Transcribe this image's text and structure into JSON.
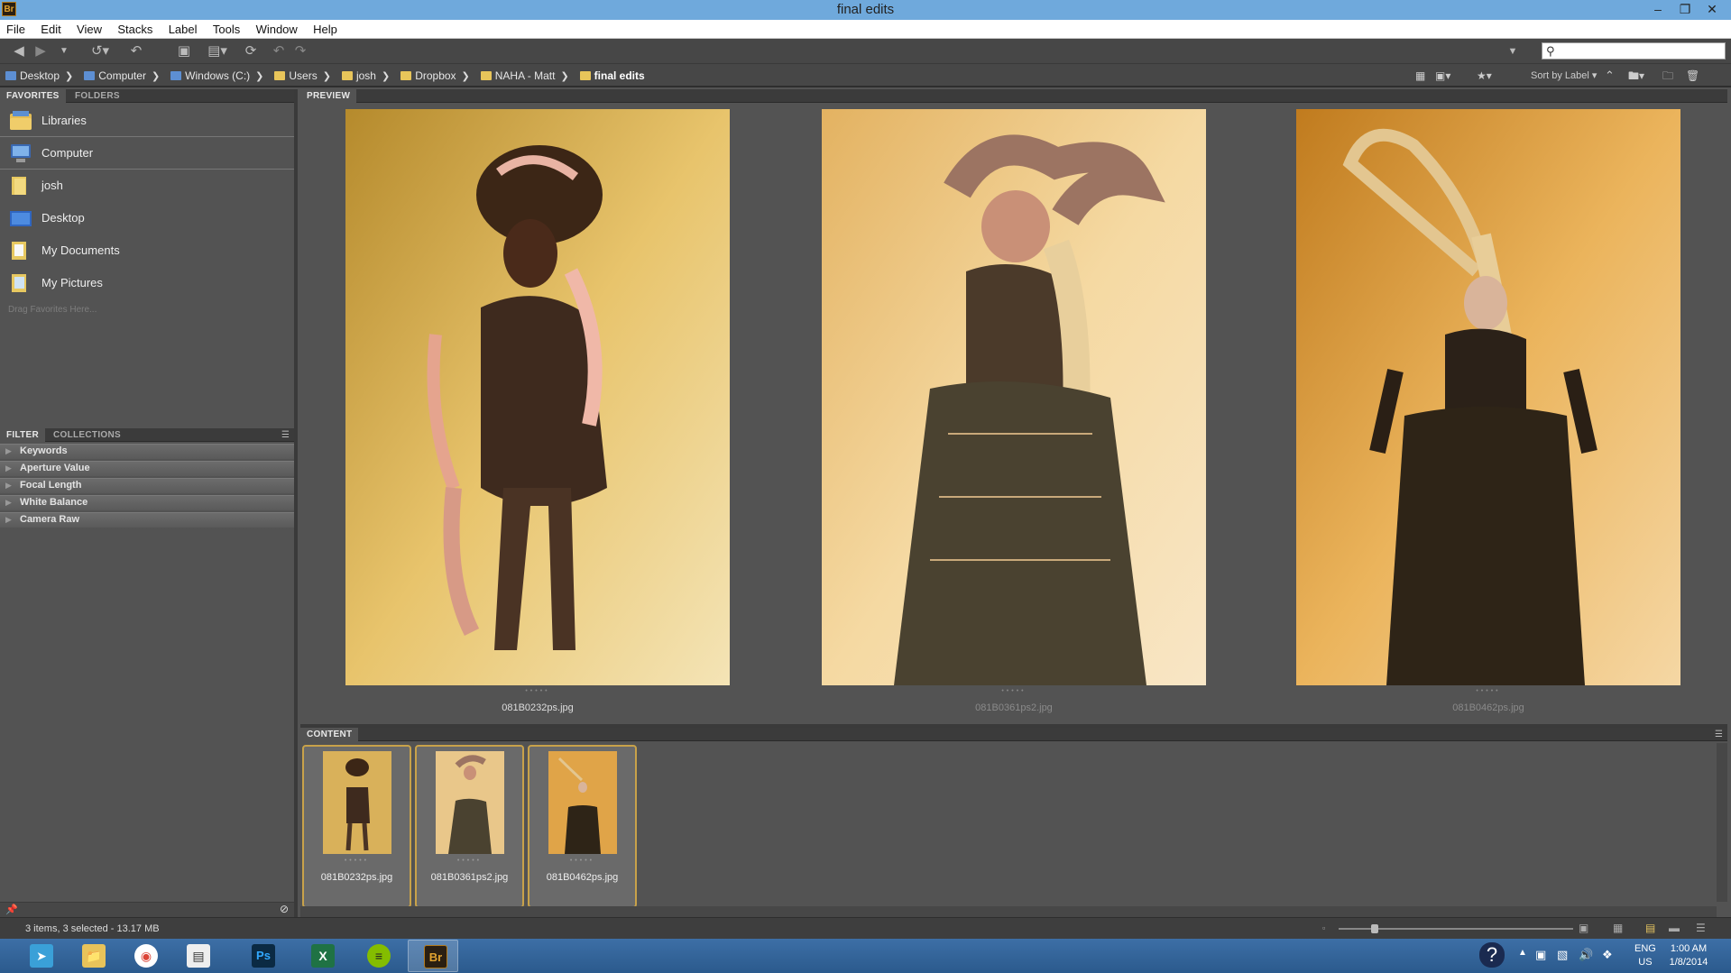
{
  "window": {
    "title": "final edits",
    "app_icon": "Br"
  },
  "menu": [
    "File",
    "Edit",
    "View",
    "Stacks",
    "Label",
    "Tools",
    "Window",
    "Help"
  ],
  "search": {
    "placeholder": ""
  },
  "breadcrumbs": [
    {
      "label": "Desktop",
      "icon": "desktop-icon"
    },
    {
      "label": "Computer",
      "icon": "computer-icon"
    },
    {
      "label": "Windows (C:)",
      "icon": "drive-icon"
    },
    {
      "label": "Users",
      "icon": "folder-icon"
    },
    {
      "label": "josh",
      "icon": "folder-icon"
    },
    {
      "label": "Dropbox",
      "icon": "dropbox-folder-icon"
    },
    {
      "label": "NAHA - Matt",
      "icon": "folder-icon"
    },
    {
      "label": "final edits",
      "icon": "folder-icon"
    }
  ],
  "sort": {
    "label": "Sort by Label"
  },
  "left_panel": {
    "tabs": {
      "favorites": "FAVORITES",
      "folders": "FOLDERS"
    },
    "favorites": [
      {
        "label": "Libraries",
        "icon": "libraries-icon"
      },
      {
        "label": "Computer",
        "icon": "computer-icon"
      },
      {
        "label": "josh",
        "icon": "user-folder-icon"
      },
      {
        "label": "Desktop",
        "icon": "desktop-icon"
      },
      {
        "label": "My Documents",
        "icon": "documents-icon"
      },
      {
        "label": "My Pictures",
        "icon": "pictures-icon"
      }
    ],
    "drag_hint": "Drag Favorites Here...",
    "filter_tabs": {
      "filter": "FILTER",
      "collections": "COLLECTIONS"
    },
    "filters": [
      "Keywords",
      "Aperture Value",
      "Focal Length",
      "White Balance",
      "Camera Raw"
    ]
  },
  "preview": {
    "tab": "PREVIEW",
    "items": [
      {
        "filename": "081B0232ps.jpg",
        "selected": true
      },
      {
        "filename": "081B0361ps2.jpg",
        "selected": false
      },
      {
        "filename": "081B0462ps.jpg",
        "selected": false
      }
    ]
  },
  "content": {
    "tab": "CONTENT",
    "items": [
      {
        "filename": "081B0232ps.jpg"
      },
      {
        "filename": "081B0361ps2.jpg"
      },
      {
        "filename": "081B0462ps.jpg"
      }
    ]
  },
  "status": {
    "text": "3 items, 3 selected - 13.17 MB"
  },
  "taskbar": {
    "apps": [
      "Bridge pinned app",
      "File Explorer",
      "Chrome",
      "Window",
      "Photoshop",
      "Excel",
      "Spotify",
      "Bridge"
    ],
    "lang": {
      "line1": "ENG",
      "line2": "US"
    },
    "clock": {
      "time": "1:00 AM",
      "date": "1/8/2014"
    }
  },
  "colors": {
    "titlebar": "#6fa9dc",
    "panel": "#535353",
    "selection_border": "#c8a24a",
    "taskbar": "#2b5a8d"
  }
}
